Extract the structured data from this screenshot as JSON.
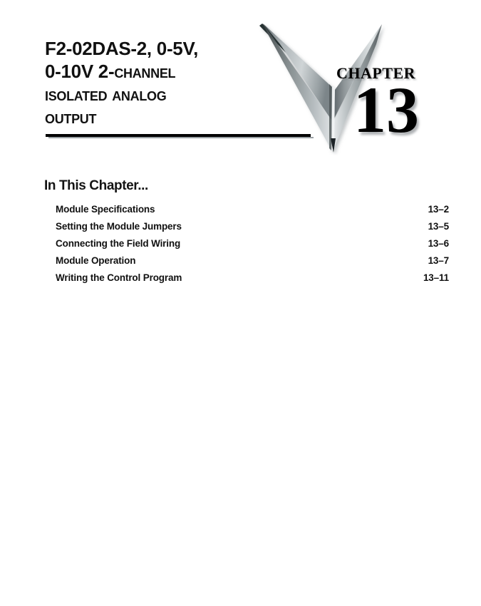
{
  "chapter": {
    "logo_icon": "downward-chevron-logo",
    "chapter_word": "Chapter",
    "chapter_number": "13",
    "title_lines": [
      {
        "plain": "F2-02DAS-2, 0-5V,"
      },
      {
        "plain": "0-10V 2-",
        "smallcaps": "Channel"
      },
      {
        "plain": "",
        "lead": "I",
        "smallcaps": "solated ",
        "lead2": "A",
        "smallcaps2": "nalog"
      },
      {
        "plain": "",
        "lead": "O",
        "smallcaps": "utput"
      }
    ]
  },
  "title": {
    "line1": "F2-02DAS-2, 0-5V,",
    "line2_plain": "0-10V 2-",
    "line2_sc": "Channel",
    "line3_sc_a": "Isolated",
    "line3_sc_b": "Analog",
    "line4_sc": "Output"
  },
  "toc": {
    "heading": "In This Chapter...",
    "items": [
      {
        "label": "Module Specifications",
        "page": "13–2"
      },
      {
        "label": "Setting the Module Jumpers",
        "page": "13–5"
      },
      {
        "label": "Connecting the Field Wiring",
        "page": "13–6"
      },
      {
        "label": "Module Operation",
        "page": "13–7"
      },
      {
        "label": "Writing the Control Program",
        "page": "13–11"
      }
    ]
  },
  "colors": {
    "text": "#111111",
    "rule": "#000000",
    "rule_shadow": "#9aa1a4",
    "logo_light": "#e6e9ea",
    "logo_mid": "#9ba3a6",
    "logo_dark": "#4d5557",
    "logo_darkest": "#20282a"
  }
}
